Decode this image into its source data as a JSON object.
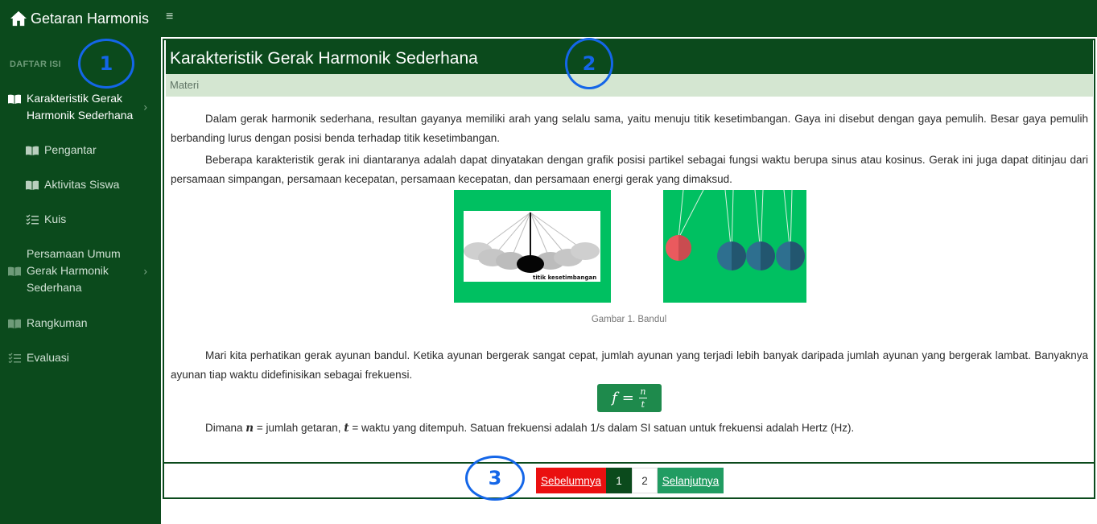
{
  "app": {
    "title": "Getaran Harmonis",
    "menu_icon": "hamburger-icon"
  },
  "sidebar": {
    "header": "DAFTAR ISI",
    "items": [
      {
        "label": "Karakteristik Gerak Harmonik Sederhana",
        "icon": "book-icon",
        "active": true,
        "has_children": true
      },
      {
        "label": "Pengantar",
        "icon": "book-icon",
        "sub": true
      },
      {
        "label": "Aktivitas Siswa",
        "icon": "book-icon",
        "sub": true
      },
      {
        "label": "Kuis",
        "icon": "checklist-icon",
        "sub": true
      },
      {
        "label": "Persamaan Umum Gerak Harmonik Sederhana",
        "icon": "book-icon",
        "has_children": true
      },
      {
        "label": "Rangkuman",
        "icon": "book-icon"
      },
      {
        "label": "Evaluasi",
        "icon": "checklist-icon"
      }
    ]
  },
  "content": {
    "title": "Karakteristik Gerak Harmonik Sederhana",
    "subtitle": "Materi",
    "paragraphs": [
      "Dalam gerak harmonik sederhana, resultan gayanya memiliki arah yang selalu sama, yaitu menuju titik kesetimbangan. Gaya ini disebut dengan gaya pemulih. Besar gaya pemulih berbanding lurus dengan posisi benda terhadap titik kesetimbangan.",
      "Beberapa karakteristik gerak ini diantaranya adalah dapat dinyatakan dengan grafik posisi partikel sebagai fungsi waktu berupa sinus atau kosinus. Gerak ini juga dapat ditinjau dari persamaan simpangan, persamaan kecepatan, persamaan kecepatan, dan persamaan energi gerak yang dimaksud."
    ],
    "figure_label": "titik kesetimbangan",
    "figure_caption": "Gambar 1. Bandul",
    "paragraph3": "Mari kita perhatikan gerak ayunan bandul. Ketika ayunan bergerak sangat cepat, jumlah ayunan yang terjadi lebih banyak daripada jumlah ayunan yang bergerak lambat. Banyaknya ayunan tiap waktu didefinisikan sebagai frekuensi.",
    "formula": {
      "lhs": "f",
      "eq": "=",
      "num": "n",
      "den": "t"
    },
    "paragraph4": {
      "prefix": "Dimana ",
      "var_n": "n",
      "mid": " = jumlah getaran, ",
      "var_t": "t",
      "suffix": " = waktu yang ditempuh. Satuan frekuensi adalah 1/s dalam SI satuan untuk frekuensi adalah Hertz (Hz)."
    }
  },
  "pagination": {
    "prev": "Sebelumnya",
    "pages": [
      "1",
      "2"
    ],
    "current": "1",
    "next": "Selanjutnya"
  },
  "callouts": [
    "1",
    "2",
    "3"
  ],
  "colors": {
    "dark_green": "#0b4a1c",
    "light_green": "#d4e6d1",
    "figure_green": "#00c061",
    "prev_red": "#ea1010",
    "next_green": "#219c62",
    "callout_blue": "#1466e8"
  }
}
